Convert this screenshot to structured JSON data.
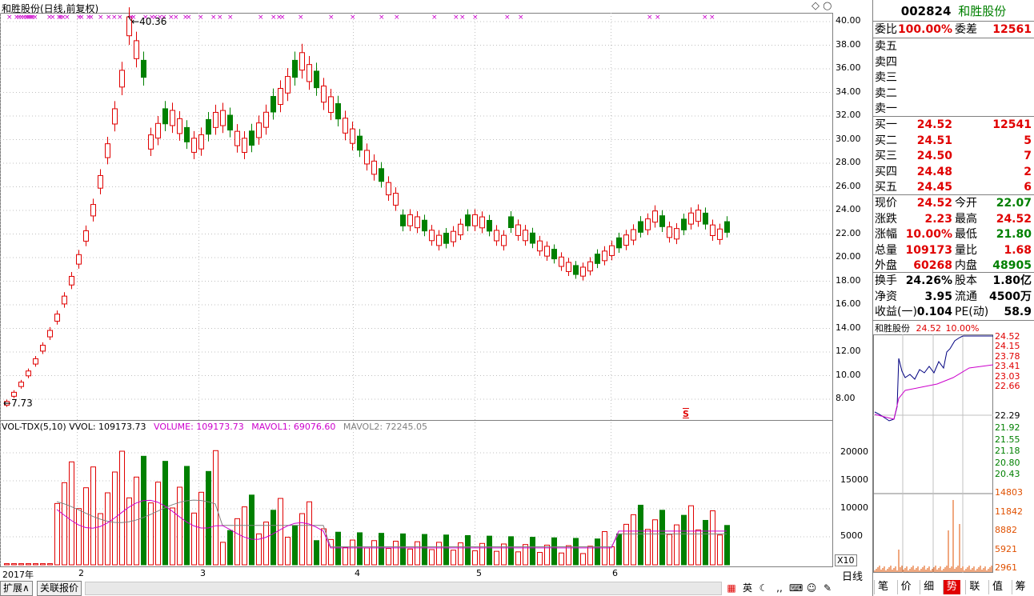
{
  "title": "和胜股份(日线,前复权)",
  "price_axis": [
    "40.00",
    "38.00",
    "36.00",
    "34.00",
    "32.00",
    "30.00",
    "28.00",
    "26.00",
    "24.00",
    "22.00",
    "20.00",
    "18.00",
    "16.00",
    "14.00",
    "12.00",
    "10.00",
    "8.00"
  ],
  "annotations": {
    "high": "40.36",
    "low": "7.73",
    "marker": "S"
  },
  "vol_header": {
    "name": "VOL-TDX(5,10)",
    "vvol": "VVOL: 109173.73",
    "volume": "VOLUME: 109173.73",
    "mavol1": "MAVOL1: 69076.60",
    "mavol2": "MAVOL2: 72245.05"
  },
  "vol_axis": [
    "20000",
    "15000",
    "10000",
    "5000"
  ],
  "vol_unit": "X10",
  "period_label": "日线",
  "date_axis": [
    "2017年",
    "2",
    "3",
    "4",
    "5",
    "6"
  ],
  "bottom_tabs": [
    "扩展∧",
    "关联报价"
  ],
  "side": {
    "code": "002824",
    "name": "和胜股份",
    "weibi": {
      "label": "委比",
      "value": "100.00%",
      "label2": "委差",
      "value2": "12561"
    },
    "sells": [
      {
        "label": "卖五"
      },
      {
        "label": "卖四"
      },
      {
        "label": "卖三"
      },
      {
        "label": "卖二"
      },
      {
        "label": "卖一"
      }
    ],
    "buys": [
      {
        "label": "买一",
        "price": "24.52",
        "vol": "12541"
      },
      {
        "label": "买二",
        "price": "24.51",
        "vol": "5"
      },
      {
        "label": "买三",
        "price": "24.50",
        "vol": "7"
      },
      {
        "label": "买四",
        "price": "24.48",
        "vol": "2"
      },
      {
        "label": "买五",
        "price": "24.45",
        "vol": "6"
      }
    ],
    "quote": [
      {
        "l1": "现价",
        "v1": "24.52",
        "l2": "今开",
        "v2": "22.07"
      },
      {
        "l1": "涨跌",
        "v1": "2.23",
        "l2": "最高",
        "v2": "24.52"
      },
      {
        "l1": "涨幅",
        "v1": "10.00%",
        "l2": "最低",
        "v2": "21.80"
      },
      {
        "l1": "总量",
        "v1": "109173",
        "l2": "量比",
        "v2": "1.68"
      },
      {
        "l1": "外盘",
        "v1": "60268",
        "l2": "内盘",
        "v2": "48905"
      }
    ],
    "fin": [
      {
        "l1": "换手",
        "v1": "24.26%",
        "l2": "股本",
        "v2": "1.80亿"
      },
      {
        "l1": "净资",
        "v1": "3.95",
        "l2": "流通",
        "v2": "4500万"
      },
      {
        "l1": "收益(一)",
        "v1": "0.104",
        "l2": "PE(动)",
        "v2": "58.9"
      }
    ],
    "mini": {
      "name": "和胜股份",
      "price": "24.52",
      "pct": "10.00%",
      "axis_up": [
        "24.52",
        "24.15",
        "23.78",
        "23.41",
        "23.03",
        "22.66"
      ],
      "axis_mid": "22.29",
      "axis_down": [
        "21.92",
        "21.55",
        "21.18",
        "20.80",
        "20.43"
      ],
      "vol_axis": [
        "14803",
        "11842",
        "8882",
        "5921",
        "2961"
      ]
    },
    "tabs": [
      "笔",
      "价",
      "细",
      "势",
      "联",
      "值",
      "筹"
    ],
    "active_tab": "势"
  },
  "colors": {
    "up": "#e00000",
    "down": "#008000",
    "ma1": "#cc00cc",
    "ma2": "#808080",
    "grid": "#c0c0c0",
    "border": "#808080"
  }
}
